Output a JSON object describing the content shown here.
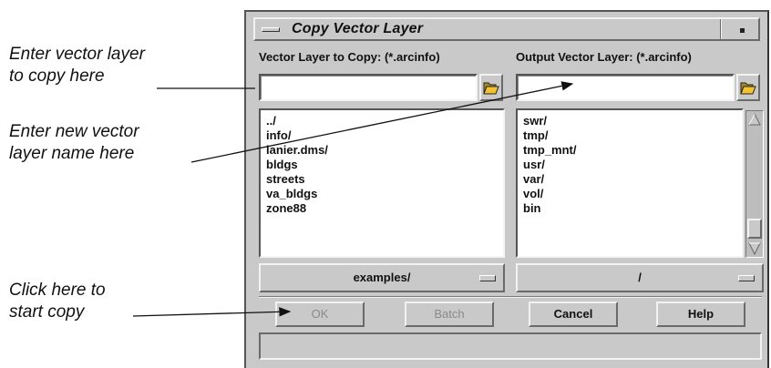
{
  "annotations": {
    "vector_input": [
      "Enter vector layer",
      "to copy here"
    ],
    "output_name": [
      "Enter new vector",
      "layer name here"
    ],
    "ok_button": [
      "Click here to",
      "start copy"
    ]
  },
  "dialog": {
    "title": "Copy Vector Layer",
    "input_label": "Vector Layer to Copy: (*.arcinfo)",
    "output_label": "Output Vector Layer: (*.arcinfo)",
    "input_value": "",
    "output_value": "",
    "input_list": [
      "../",
      "info/",
      "lanier.dms/",
      "bldgs",
      "streets",
      "va_bldgs",
      "zone88"
    ],
    "output_list": [
      "swr/",
      "tmp/",
      "tmp_mnt/",
      "usr/",
      "var/",
      "vol/",
      "bin"
    ],
    "input_dir": "examples/",
    "output_dir": "/",
    "buttons": {
      "ok": "OK",
      "batch": "Batch",
      "cancel": "Cancel",
      "help": "Help"
    },
    "status_text": ""
  },
  "icons": {
    "input_browse": "folder-open-icon",
    "output_browse": "folder-open-icon",
    "menu": "window-menu-icon",
    "minimize": "minimize-icon"
  },
  "colors": {
    "dialog_bg": "#c9c9c9",
    "folder_yellow": "#f1c232"
  }
}
